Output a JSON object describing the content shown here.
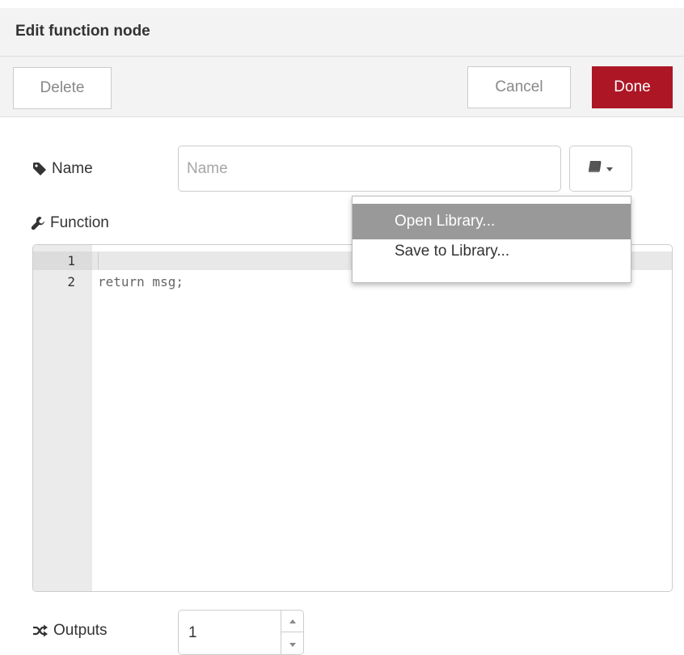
{
  "dialog": {
    "title": "Edit function node"
  },
  "toolbar": {
    "delete_label": "Delete",
    "cancel_label": "Cancel",
    "done_label": "Done"
  },
  "form": {
    "name_label": "Name",
    "name_placeholder": "Name",
    "name_value": "",
    "function_label": "Function",
    "outputs_label": "Outputs",
    "outputs_value": "1"
  },
  "library_menu": {
    "button_icon": "book-icon",
    "items": [
      {
        "label": "Open Library..."
      },
      {
        "label": "Save to Library..."
      }
    ]
  },
  "editor": {
    "lines": [
      {
        "num": "1",
        "code": ""
      },
      {
        "num": "2",
        "code": "return msg;"
      }
    ]
  },
  "icons": {
    "name": "tag-icon",
    "function": "wrench-icon",
    "outputs": "random-icon"
  },
  "colors": {
    "done_button": "#ad1625",
    "menu_highlight": "#999999"
  }
}
